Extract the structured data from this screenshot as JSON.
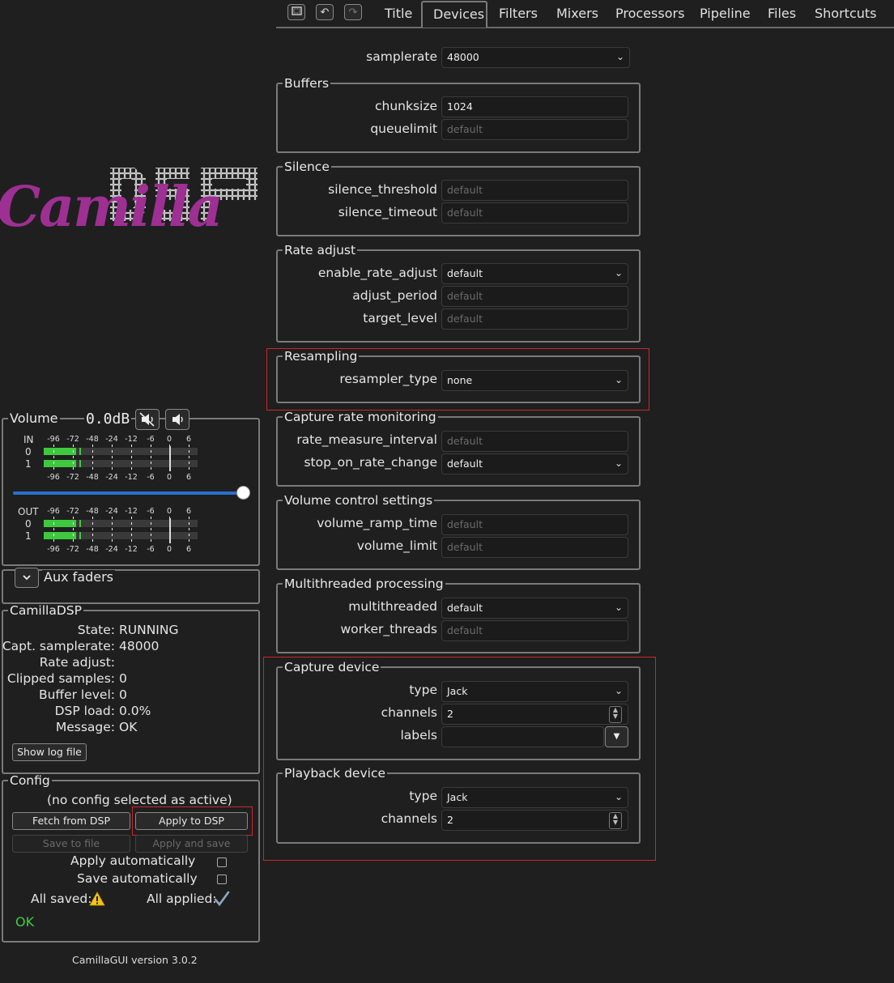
{
  "toolbar": {
    "icons": [
      "window-icon",
      "undo-icon",
      "redo-icon"
    ]
  },
  "tabs": [
    "Title",
    "Devices",
    "Filters",
    "Mixers",
    "Processors",
    "Pipeline",
    "Files",
    "Shortcuts"
  ],
  "active_tab": "Devices",
  "logo": {
    "script_text": "Camilla",
    "block_text": "DSP"
  },
  "volume": {
    "label": "Volume",
    "value": "0.0dB",
    "in_label": "IN",
    "out_label": "OUT",
    "scale": [
      "-96",
      "-72",
      "-48",
      "-24",
      "-12",
      "-6",
      "0",
      "6"
    ],
    "channels": [
      "0",
      "1"
    ],
    "in_levels": [
      0.16,
      0.16
    ],
    "out_levels": [
      0.16,
      0.16
    ],
    "slider_level": 1.0
  },
  "aux": {
    "label": "Aux faders"
  },
  "status": {
    "title": "CamillaDSP",
    "rows": [
      {
        "label": "State:",
        "value": "RUNNING"
      },
      {
        "label": "Capt. samplerate:",
        "value": "48000"
      },
      {
        "label": "Rate adjust:",
        "value": ""
      },
      {
        "label": "Clipped samples:",
        "value": "0"
      },
      {
        "label": "Buffer level:",
        "value": "0"
      },
      {
        "label": "DSP load:",
        "value": "0.0%"
      },
      {
        "label": "Message:",
        "value": "OK"
      }
    ],
    "log_button": "Show log file"
  },
  "config": {
    "title": "Config",
    "active_text": "(no config selected as active)",
    "fetch": "Fetch from DSP",
    "apply": "Apply to DSP",
    "save_file": "Save to file",
    "apply_save": "Apply and save",
    "apply_auto": "Apply automatically",
    "save_auto": "Save automatically",
    "all_saved": "All saved:",
    "all_applied": "All applied:",
    "ok": "OK",
    "ok_color": "#3ecf3e"
  },
  "version": "CamillaGUI version 3.0.2",
  "devices": {
    "samplerate": {
      "label": "samplerate",
      "value": "48000"
    },
    "buffers": {
      "title": "Buffers",
      "chunksize": {
        "label": "chunksize",
        "value": "1024"
      },
      "queuelimit": {
        "label": "queuelimit",
        "placeholder": "default"
      }
    },
    "silence": {
      "title": "Silence",
      "threshold": {
        "label": "silence_threshold",
        "placeholder": "default"
      },
      "timeout": {
        "label": "silence_timeout",
        "placeholder": "default"
      }
    },
    "rate": {
      "title": "Rate adjust",
      "enable": {
        "label": "enable_rate_adjust",
        "value": "default"
      },
      "period": {
        "label": "adjust_period",
        "placeholder": "default"
      },
      "target": {
        "label": "target_level",
        "placeholder": "default"
      }
    },
    "resampling": {
      "title": "Resampling",
      "type": {
        "label": "resampler_type",
        "value": "none"
      }
    },
    "capture_rate": {
      "title": "Capture rate monitoring",
      "interval": {
        "label": "rate_measure_interval",
        "placeholder": "default"
      },
      "stop": {
        "label": "stop_on_rate_change",
        "value": "default"
      }
    },
    "volume_ctrl": {
      "title": "Volume control settings",
      "ramp": {
        "label": "volume_ramp_time",
        "placeholder": "default"
      },
      "limit": {
        "label": "volume_limit",
        "placeholder": "default"
      }
    },
    "multithread": {
      "title": "Multithreaded processing",
      "mt": {
        "label": "multithreaded",
        "value": "default"
      },
      "workers": {
        "label": "worker_threads",
        "placeholder": "default"
      }
    },
    "capture": {
      "title": "Capture device",
      "type": {
        "label": "type",
        "value": "Jack"
      },
      "channels": {
        "label": "channels",
        "value": "2"
      },
      "labels": {
        "label": "labels",
        "value": ""
      }
    },
    "playback": {
      "title": "Playback device",
      "type": {
        "label": "type",
        "value": "Jack"
      },
      "channels": {
        "label": "channels",
        "value": "2"
      }
    }
  },
  "colors": {
    "meter_green": "#3ec83e",
    "slider_blue": "#2a6fd1",
    "highlight_red": "#c8272d"
  }
}
